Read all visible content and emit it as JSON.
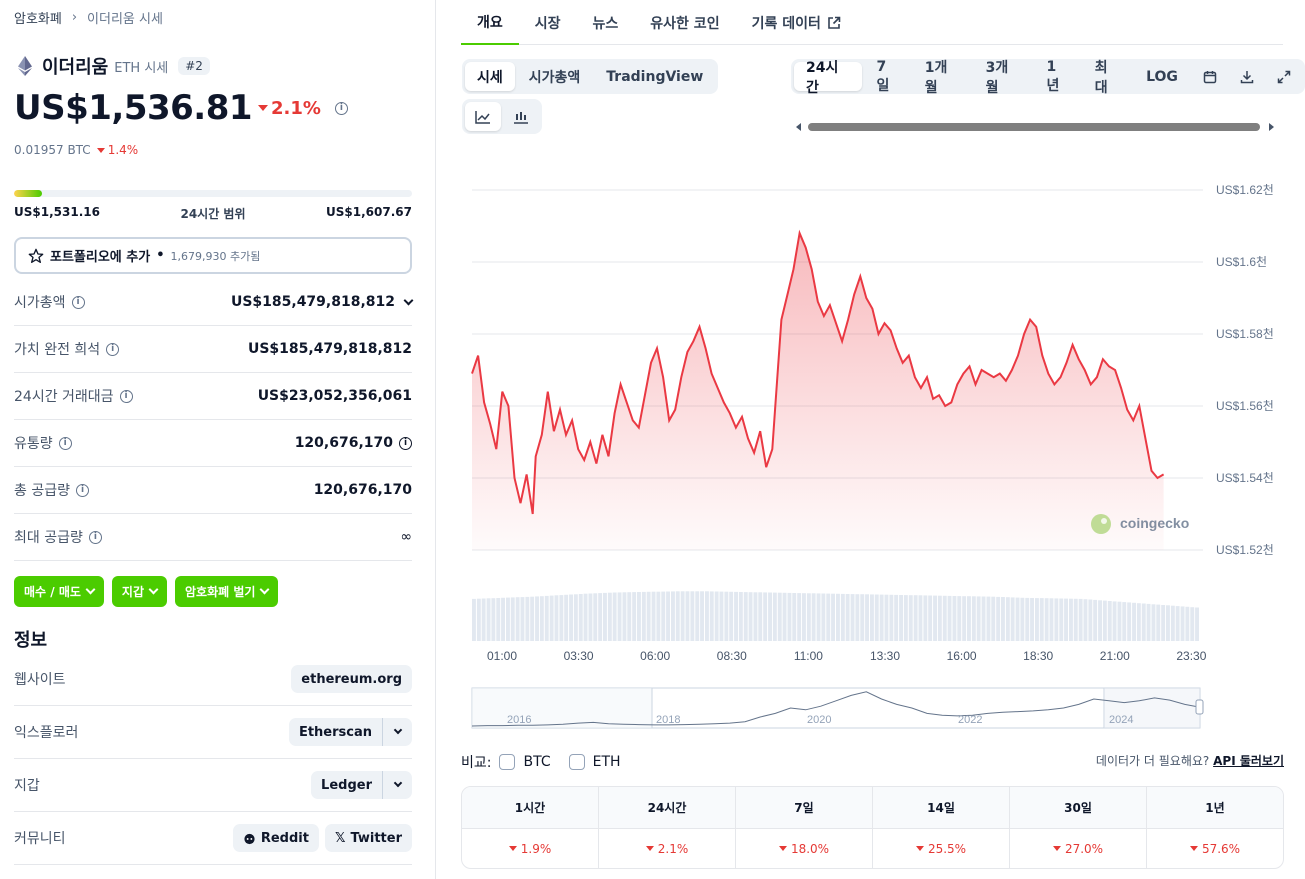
{
  "breadcrumb": {
    "root": "암호화폐",
    "current": "이더리움 시세"
  },
  "coin": {
    "name": "이더리움",
    "symbol_label": "ETH 시세",
    "rank": "#2",
    "price": "US$1,536.81",
    "change": "2.1%",
    "btc_price": "0.01957 BTC",
    "btc_change": "1.4%"
  },
  "range": {
    "low": "US$1,531.16",
    "label": "24시간 범위",
    "high": "US$1,607.67",
    "position_fraction": 0.07
  },
  "portfolio": {
    "label": "포트폴리오에 추가",
    "sep": "•",
    "count": "1,679,930 추가됨"
  },
  "stats": [
    {
      "label": "시가총액",
      "value": "US$185,479,818,812",
      "info": true,
      "chevron": true
    },
    {
      "label": "가치 완전 희석",
      "value": "US$185,479,818,812",
      "info": true
    },
    {
      "label": "24시간 거래대금",
      "value": "US$23,052,356,061",
      "info": true
    },
    {
      "label": "유통량",
      "value": "120,676,170",
      "info": true,
      "value_info": true
    },
    {
      "label": "총 공급량",
      "value": "120,676,170",
      "info": true
    },
    {
      "label": "최대 공급량",
      "value": "∞",
      "info": true
    }
  ],
  "actions": [
    "매수 / 매도",
    "지갑",
    "암호화폐 벌기"
  ],
  "info": {
    "title": "정보",
    "website_label": "웹사이트",
    "website": "ethereum.org",
    "explorer_label": "익스플로러",
    "explorer": "Etherscan",
    "wallet_label": "지갑",
    "wallet": "Ledger",
    "community_label": "커뮤니티",
    "reddit": "Reddit",
    "twitter": "Twitter"
  },
  "tabs": [
    "개요",
    "시장",
    "뉴스",
    "유사한 코인",
    "기록 데이터"
  ],
  "chart_modes": [
    "시세",
    "시가총액",
    "TradingView"
  ],
  "timeframes": [
    "24시간",
    "7일",
    "1개월",
    "3개월",
    "1년",
    "최대",
    "LOG"
  ],
  "watermark": "coingecko",
  "colors": {
    "green": "#4bcc00",
    "red": "#e53935",
    "line": "#ea3943"
  },
  "chart_data": {
    "type": "area",
    "y_tick_labels": [
      "US$1.62천",
      "US$1.6천",
      "US$1.58천",
      "US$1.56천",
      "US$1.54천",
      "US$1.52천"
    ],
    "y_ticks": [
      1620,
      1600,
      1580,
      1560,
      1540,
      1520
    ],
    "ylim": [
      1520,
      1620
    ],
    "x_tick_labels": [
      "01:00",
      "03:30",
      "06:00",
      "08:30",
      "11:00",
      "13:30",
      "16:00",
      "18:30",
      "21:00",
      "23:30"
    ],
    "x_range_hours": [
      0,
      24
    ],
    "grid": true,
    "price_series": [
      [
        0,
        1569
      ],
      [
        0.2,
        1574
      ],
      [
        0.4,
        1561
      ],
      [
        0.6,
        1555
      ],
      [
        0.8,
        1548
      ],
      [
        1.0,
        1564
      ],
      [
        1.2,
        1560
      ],
      [
        1.4,
        1540
      ],
      [
        1.6,
        1533
      ],
      [
        1.8,
        1541
      ],
      [
        2.0,
        1530
      ],
      [
        2.1,
        1546
      ],
      [
        2.3,
        1552
      ],
      [
        2.5,
        1564
      ],
      [
        2.7,
        1553
      ],
      [
        2.9,
        1559
      ],
      [
        3.1,
        1552
      ],
      [
        3.3,
        1556
      ],
      [
        3.5,
        1548
      ],
      [
        3.7,
        1545
      ],
      [
        3.9,
        1550
      ],
      [
        4.1,
        1544
      ],
      [
        4.3,
        1552
      ],
      [
        4.5,
        1546
      ],
      [
        4.7,
        1558
      ],
      [
        4.9,
        1566
      ],
      [
        5.1,
        1561
      ],
      [
        5.3,
        1556
      ],
      [
        5.5,
        1554
      ],
      [
        5.7,
        1563
      ],
      [
        5.9,
        1572
      ],
      [
        6.1,
        1576
      ],
      [
        6.3,
        1568
      ],
      [
        6.5,
        1556
      ],
      [
        6.7,
        1559
      ],
      [
        6.9,
        1568
      ],
      [
        7.1,
        1575
      ],
      [
        7.3,
        1578
      ],
      [
        7.5,
        1582
      ],
      [
        7.7,
        1576
      ],
      [
        7.9,
        1569
      ],
      [
        8.1,
        1565
      ],
      [
        8.3,
        1561
      ],
      [
        8.5,
        1558
      ],
      [
        8.7,
        1554
      ],
      [
        8.9,
        1557
      ],
      [
        9.1,
        1551
      ],
      [
        9.3,
        1547
      ],
      [
        9.5,
        1553
      ],
      [
        9.7,
        1543
      ],
      [
        9.9,
        1548
      ],
      [
        10.0,
        1560
      ],
      [
        10.2,
        1584
      ],
      [
        10.4,
        1591
      ],
      [
        10.6,
        1598
      ],
      [
        10.8,
        1608
      ],
      [
        11.0,
        1604
      ],
      [
        11.2,
        1598
      ],
      [
        11.4,
        1589
      ],
      [
        11.6,
        1585
      ],
      [
        11.8,
        1588
      ],
      [
        12.0,
        1583
      ],
      [
        12.2,
        1578
      ],
      [
        12.4,
        1584
      ],
      [
        12.6,
        1591
      ],
      [
        12.8,
        1596
      ],
      [
        13.0,
        1590
      ],
      [
        13.2,
        1587
      ],
      [
        13.4,
        1580
      ],
      [
        13.6,
        1583
      ],
      [
        13.8,
        1581
      ],
      [
        14.0,
        1576
      ],
      [
        14.2,
        1572
      ],
      [
        14.4,
        1574
      ],
      [
        14.6,
        1568
      ],
      [
        14.8,
        1565
      ],
      [
        15.0,
        1568
      ],
      [
        15.2,
        1562
      ],
      [
        15.4,
        1563
      ],
      [
        15.6,
        1560
      ],
      [
        15.8,
        1561
      ],
      [
        16.0,
        1566
      ],
      [
        16.2,
        1569
      ],
      [
        16.4,
        1571
      ],
      [
        16.6,
        1566
      ],
      [
        16.8,
        1570
      ],
      [
        17.0,
        1569
      ],
      [
        17.2,
        1568
      ],
      [
        17.4,
        1569
      ],
      [
        17.6,
        1567
      ],
      [
        17.8,
        1570
      ],
      [
        18.0,
        1574
      ],
      [
        18.2,
        1580
      ],
      [
        18.4,
        1584
      ],
      [
        18.6,
        1582
      ],
      [
        18.8,
        1574
      ],
      [
        19.0,
        1569
      ],
      [
        19.2,
        1566
      ],
      [
        19.4,
        1568
      ],
      [
        19.6,
        1572
      ],
      [
        19.8,
        1577
      ],
      [
        20.0,
        1573
      ],
      [
        20.2,
        1570
      ],
      [
        20.4,
        1566
      ],
      [
        20.6,
        1568
      ],
      [
        20.8,
        1573
      ],
      [
        21.0,
        1571
      ],
      [
        21.2,
        1570
      ],
      [
        21.4,
        1565
      ],
      [
        21.6,
        1559
      ],
      [
        21.8,
        1556
      ],
      [
        22.0,
        1560
      ],
      [
        22.2,
        1551
      ],
      [
        22.4,
        1542
      ],
      [
        22.6,
        1540
      ],
      [
        22.8,
        1541
      ]
    ],
    "volume_series_relative": [
      0.78,
      0.8,
      0.82,
      0.85,
      0.88,
      0.9,
      0.91,
      0.92,
      0.92,
      0.91,
      0.9,
      0.89,
      0.88,
      0.87,
      0.86,
      0.85,
      0.84,
      0.83,
      0.82,
      0.8,
      0.79,
      0.78,
      0.74,
      0.7,
      0.66,
      0.62
    ],
    "overview_x_tick_labels": [
      "2016",
      "2018",
      "2020",
      "2022",
      "2024"
    ]
  },
  "compare": {
    "label": "비교:",
    "options": [
      "BTC",
      "ETH"
    ]
  },
  "api": {
    "text": "데이터가 더 필요해요?",
    "link": "API 둘러보기"
  },
  "performance": [
    {
      "period": "1시간",
      "value": "1.9%"
    },
    {
      "period": "24시간",
      "value": "2.1%"
    },
    {
      "period": "7일",
      "value": "18.0%"
    },
    {
      "period": "14일",
      "value": "25.5%"
    },
    {
      "period": "30일",
      "value": "27.0%"
    },
    {
      "period": "1년",
      "value": "57.6%"
    }
  ]
}
